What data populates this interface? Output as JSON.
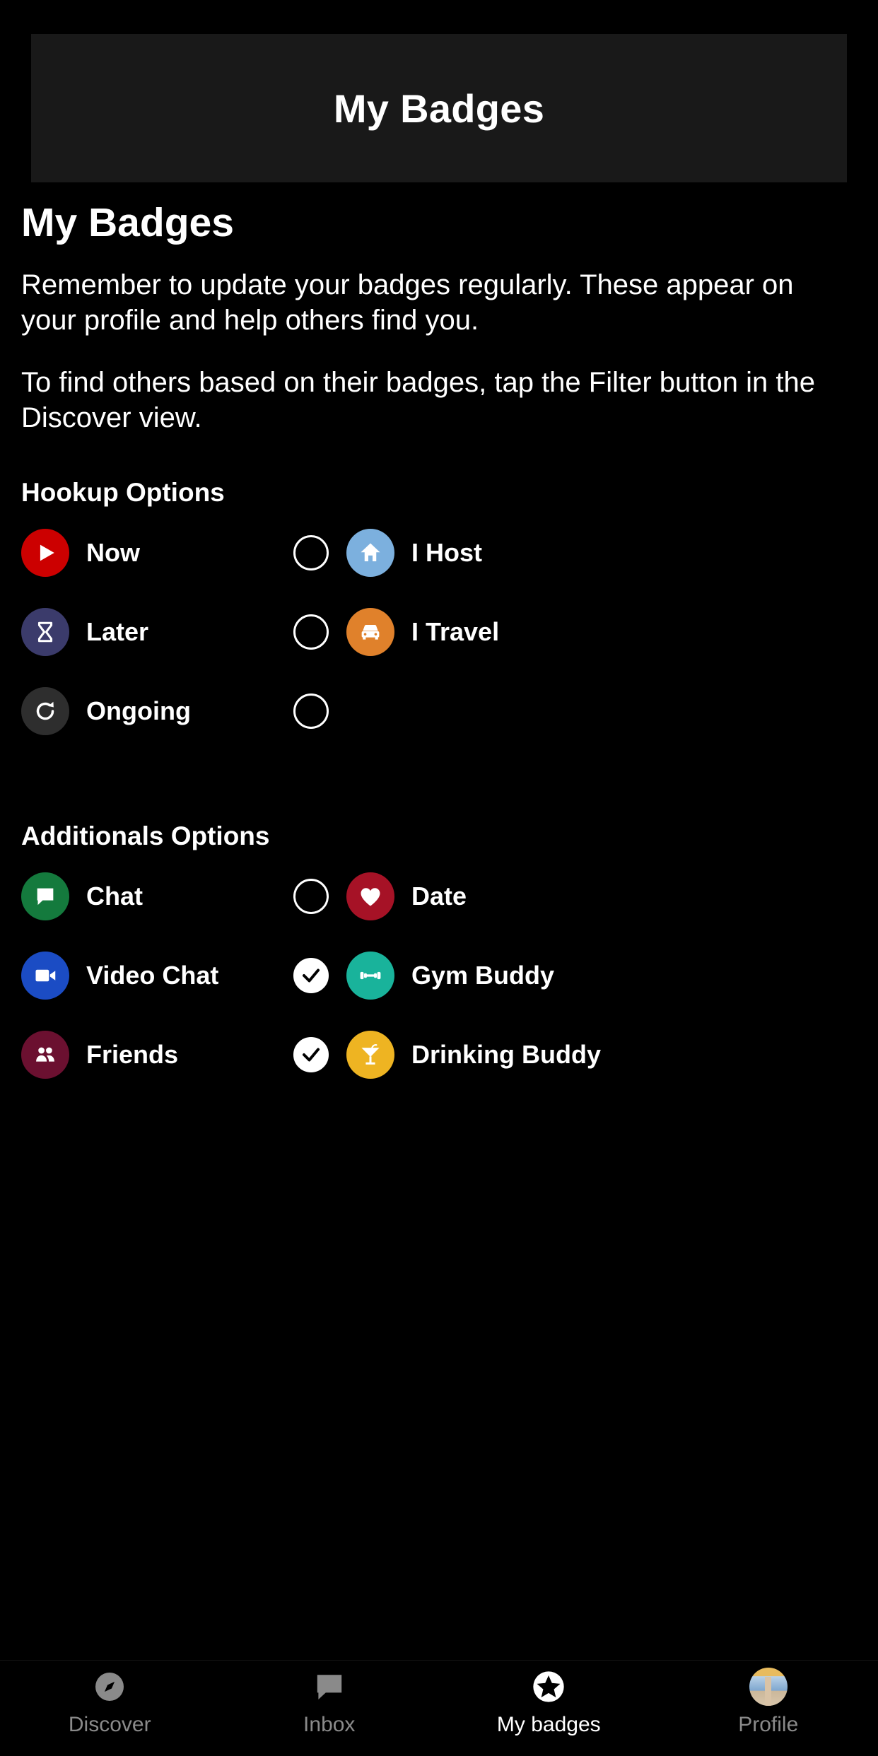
{
  "header": {
    "title": "My Badges"
  },
  "main": {
    "page_title": "My Badges",
    "paragraph_1": "Remember to update your badges regularly. These appear on your profile and help others find you.",
    "paragraph_2": "To find others based on their badges, tap the Filter button in the Discover view.",
    "sections": [
      {
        "title": "Hookup Options",
        "rows": [
          {
            "left": {
              "label": "Now",
              "icon": "play-icon",
              "color": "#cc0000",
              "checked": false
            },
            "right": {
              "label": "I Host",
              "icon": "home-icon",
              "color": "#7cb0de",
              "checked": false
            }
          },
          {
            "left": {
              "label": "Later",
              "icon": "hourglass-icon",
              "color": "#3b3b6b",
              "checked": false
            },
            "right": {
              "label": "I Travel",
              "icon": "car-icon",
              "color": "#e0812b",
              "checked": false
            }
          },
          {
            "left": {
              "label": "Ongoing",
              "icon": "refresh-icon",
              "color": "#2e2e2e",
              "checked": false
            },
            "right": {
              "label": "",
              "icon": "",
              "color": "",
              "checked": false
            }
          }
        ]
      },
      {
        "title": "Additionals Options",
        "rows": [
          {
            "left": {
              "label": "Chat",
              "icon": "chat-bubble-icon",
              "color": "#147a3d",
              "checked": false
            },
            "right": {
              "label": "Date",
              "icon": "heart-icon",
              "color": "#a61226",
              "checked": false
            }
          },
          {
            "left": {
              "label": "Video Chat",
              "icon": "video-camera-icon",
              "color": "#1b4cc4",
              "checked": true
            },
            "right": {
              "label": "Gym Buddy",
              "icon": "dumbbell-icon",
              "color": "#19b39b",
              "checked": false
            }
          },
          {
            "left": {
              "label": "Friends",
              "icon": "people-icon",
              "color": "#6b1030",
              "checked": true
            },
            "right": {
              "label": "Drinking Buddy",
              "icon": "cocktail-icon",
              "color": "#eeb422",
              "checked": false
            }
          }
        ]
      }
    ]
  },
  "bottom_nav": {
    "items": [
      {
        "label": "Discover",
        "icon": "compass-icon",
        "active": false
      },
      {
        "label": "Inbox",
        "icon": "chat-bubble-icon",
        "active": false
      },
      {
        "label": "My badges",
        "icon": "star-badge-icon",
        "active": true
      },
      {
        "label": "Profile",
        "icon": "avatar-icon",
        "active": false
      }
    ]
  },
  "colors": {
    "background": "#000000",
    "header_bar": "#191919",
    "text_primary": "#ffffff",
    "text_muted": "#8a8a8a"
  }
}
